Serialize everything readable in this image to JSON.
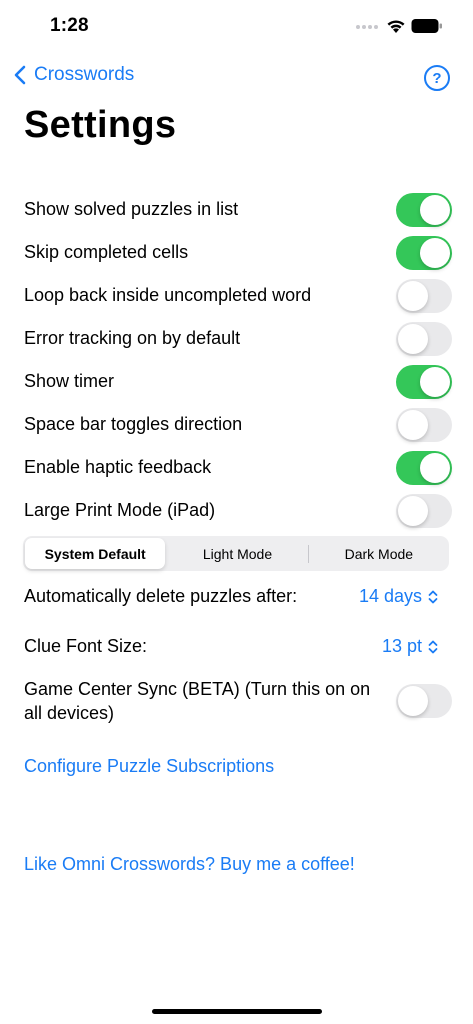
{
  "status_bar": {
    "time": "1:28"
  },
  "nav": {
    "back_label": "Crosswords",
    "help_label": "?"
  },
  "page_title": "Settings",
  "toggles": [
    {
      "label": "Show solved puzzles in list",
      "on": true
    },
    {
      "label": "Skip completed cells",
      "on": true
    },
    {
      "label": "Loop back inside uncompleted word",
      "on": false
    },
    {
      "label": "Error tracking on by default",
      "on": false
    },
    {
      "label": "Show timer",
      "on": true
    },
    {
      "label": "Space bar toggles direction",
      "on": false
    },
    {
      "label": "Enable haptic feedback",
      "on": true
    },
    {
      "label": "Large Print Mode (iPad)",
      "on": false
    }
  ],
  "appearance": {
    "options": [
      "System Default",
      "Light Mode",
      "Dark Mode"
    ],
    "selected": "System Default"
  },
  "auto_delete": {
    "label": "Automatically delete puzzles after:",
    "value": "14 days"
  },
  "clue_font": {
    "label": "Clue Font Size:",
    "value": "13 pt"
  },
  "game_center": {
    "label_line1": "Game Center Sync (BETA) (Turn this on on",
    "label_line2": "all devices)",
    "on": false
  },
  "links": {
    "subscriptions": "Configure Puzzle Subscriptions",
    "coffee": "Like Omni Crosswords? Buy me a coffee!"
  },
  "colors": {
    "accent": "#1a7cf5",
    "toggle_on": "#34c759",
    "toggle_off": "#e9e9eb"
  }
}
